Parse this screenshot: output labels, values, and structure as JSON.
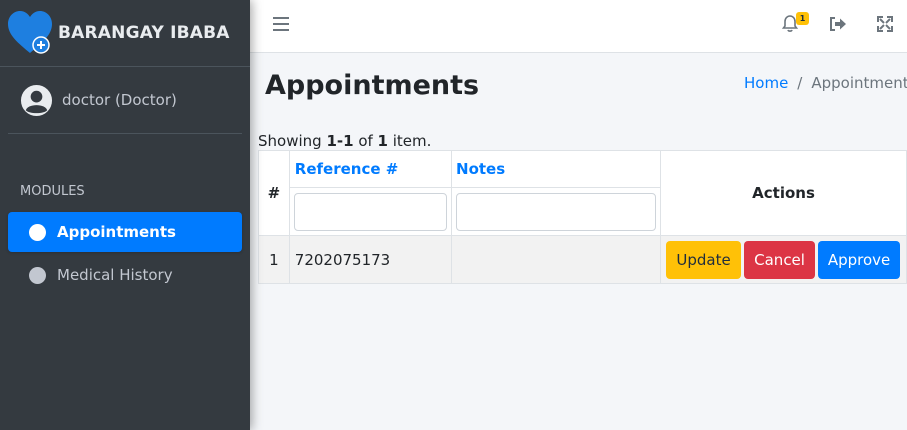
{
  "brand": {
    "name": "BARANGAY IBABA"
  },
  "user": {
    "name": "doctor (Doctor)"
  },
  "sidebar": {
    "header": "MODULES",
    "items": [
      {
        "label": "Appointments",
        "active": true
      },
      {
        "label": "Medical History",
        "active": false
      }
    ]
  },
  "topbar": {
    "menu_icon": "hamburger-icon",
    "notifications_icon": "bell-icon",
    "notification_count": "1",
    "logout_icon": "sign-out-icon",
    "fullscreen_icon": "expand-icon"
  },
  "page": {
    "title": "Appointments",
    "breadcrumb": {
      "home": "Home",
      "separator": "/",
      "current": "Appointments"
    }
  },
  "grid": {
    "summary": {
      "prefix": "Showing ",
      "range": "1-1",
      "middle": " of ",
      "total": "1",
      "suffix": " item."
    },
    "columns": {
      "num": "#",
      "reference": "Reference #",
      "notes": "Notes",
      "actions": "Actions"
    },
    "filters": {
      "reference": "",
      "notes": ""
    },
    "rows": [
      {
        "num": "1",
        "reference": "7202075173",
        "notes": ""
      }
    ],
    "buttons": {
      "update": "Update",
      "cancel": "Cancel",
      "approve": "Approve"
    }
  },
  "colors": {
    "sidebar_bg": "#343a40",
    "primary": "#007bff",
    "warning": "#ffc107",
    "danger": "#dc3545"
  }
}
